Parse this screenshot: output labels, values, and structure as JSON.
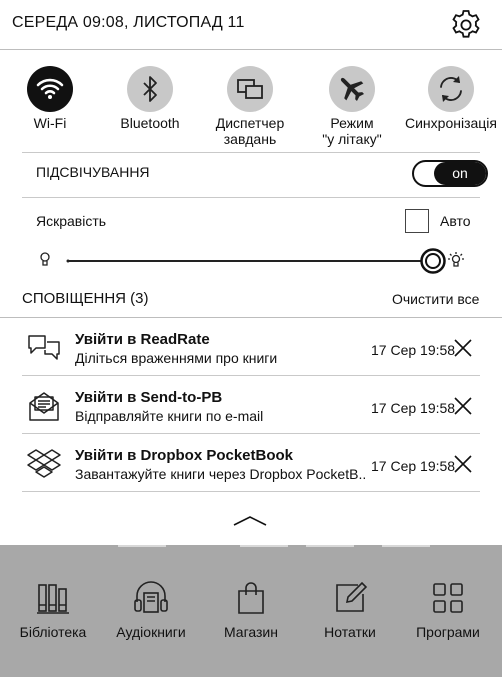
{
  "status_bar": {
    "datetime": "СЕРЕДА 09:08, ЛИСТОПАД  11"
  },
  "quick_toggles": [
    {
      "label": "Wi-Fi",
      "icon": "wifi-icon",
      "active": true
    },
    {
      "label": "Bluetooth",
      "icon": "bluetooth-icon",
      "active": false
    },
    {
      "label": "Диспетчер\nзавдань",
      "icon": "task-manager-icon",
      "active": false
    },
    {
      "label": "Режим\n\"у літаку\"",
      "icon": "airplane-icon",
      "active": false
    },
    {
      "label": "Синхронізація",
      "icon": "sync-icon",
      "active": false
    }
  ],
  "backlight": {
    "label": "ПІДСВІЧУВАННЯ",
    "toggle": "on"
  },
  "brightness": {
    "label": "Яскравість",
    "auto_label": "Авто",
    "auto_checked": false,
    "level": 1.0
  },
  "notifications": {
    "header": "СПОВІЩЕННЯ (3)",
    "clear_all": "Очистити все",
    "items": [
      {
        "icon": "readrate-icon",
        "title": "Увійти в ReadRate",
        "subtitle": "Діліться враженнями про книги",
        "time": "17 Сер 19:58"
      },
      {
        "icon": "send-to-pb-icon",
        "title": "Увійти в Send-to-PB",
        "subtitle": "Відправляйте книги по e-mail",
        "time": "17 Сер 19:58"
      },
      {
        "icon": "dropbox-icon",
        "title": "Увійти в Dropbox PocketBook",
        "subtitle": "Завантажуйте книги через Dropbox PocketB...",
        "time": "17 Сер 19:58"
      }
    ]
  },
  "dock": [
    {
      "label": "Бібліотека",
      "icon": "library-icon"
    },
    {
      "label": "Аудіокниги",
      "icon": "audiobooks-icon"
    },
    {
      "label": "Магазин",
      "icon": "store-icon"
    },
    {
      "label": "Нотатки",
      "icon": "notes-icon"
    },
    {
      "label": "Програми",
      "icon": "apps-icon"
    }
  ],
  "colors": {
    "dock_bg": "#a8a8a8",
    "inactive_circle": "#c8c8c8",
    "active_circle": "#111111"
  }
}
